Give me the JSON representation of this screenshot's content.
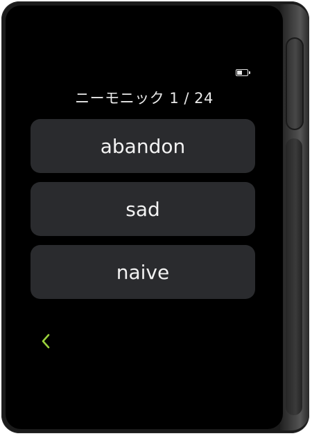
{
  "header": {
    "title": "ニーモニック 1 / 24",
    "battery_level": 0.55
  },
  "words": [
    "abandon",
    "sad",
    "naive"
  ],
  "navigation": {
    "back_icon": "chevron-left-icon"
  },
  "colors": {
    "accent": "#9bd33c",
    "screen_bg": "#000000",
    "card_bg": "#2a2b2e",
    "text": "#f3f3f3"
  }
}
